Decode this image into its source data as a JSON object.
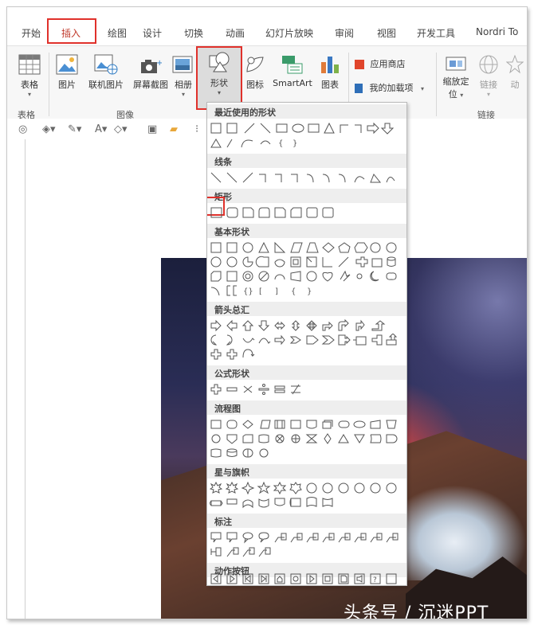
{
  "tabs": [
    {
      "label": "开始"
    },
    {
      "label": "插入",
      "active": true
    },
    {
      "label": "绘图"
    },
    {
      "label": "设计"
    },
    {
      "label": "切换"
    },
    {
      "label": "动画"
    },
    {
      "label": "幻灯片放映"
    },
    {
      "label": "审阅"
    },
    {
      "label": "视图"
    },
    {
      "label": "开发工具"
    },
    {
      "label": "Nordri To"
    }
  ],
  "ribbon": {
    "buttons": {
      "table": "表格",
      "picture": "图片",
      "online_picture": "联机图片",
      "screenshot": "屏幕截图",
      "album": "相册",
      "shapes": "形状",
      "icons": "图标",
      "smartart": "SmartArt",
      "chart": "图表",
      "store": "应用商店",
      "my_addins": "我的加载项",
      "zoom": "缩放定",
      "zoom2": "位",
      "link": "链接",
      "action": "动"
    },
    "groups": {
      "table": "表格",
      "images": "图像",
      "links": "链接"
    }
  },
  "dropdown": {
    "sections": [
      {
        "title": "最近使用的形状"
      },
      {
        "title": "线条"
      },
      {
        "title": "矩形"
      },
      {
        "title": "基本形状"
      },
      {
        "title": "箭头总汇"
      },
      {
        "title": "公式形状"
      },
      {
        "title": "流程图"
      },
      {
        "title": "星与旗帜"
      },
      {
        "title": "标注"
      },
      {
        "title": "动作按钮"
      }
    ]
  },
  "colors": {
    "accent": "#e0312b",
    "active_tab": "#c0392b"
  },
  "watermark": "头条号 / 沉迷PPT"
}
